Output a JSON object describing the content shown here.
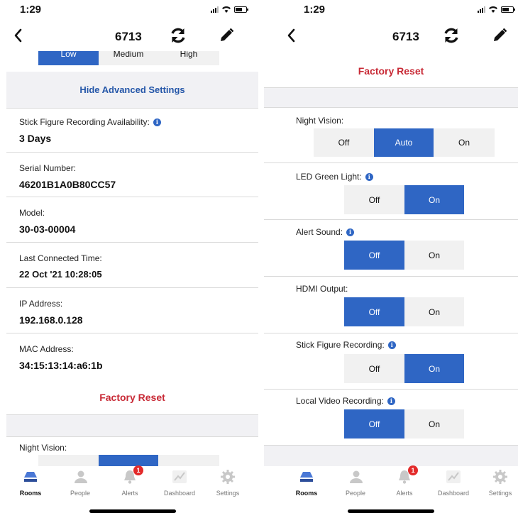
{
  "status": {
    "time": "1:29"
  },
  "device": {
    "title": "6713"
  },
  "left": {
    "sensitivity": [
      "Low",
      "Medium",
      "High"
    ],
    "advanced_link": "Hide Advanced Settings",
    "info": [
      {
        "label": "Stick Figure Recording Availability:",
        "value": "3 Days",
        "has_info": true
      },
      {
        "label": "Serial Number:",
        "value": "46201B1A0B80CC57"
      },
      {
        "label": "Model:",
        "value": "30-03-00004"
      },
      {
        "label": "Last Connected Time:",
        "value": "22 Oct '21 10:28:05"
      },
      {
        "label": "IP Address:",
        "value": "192.168.0.128"
      },
      {
        "label": "MAC Address:",
        "value": "34:15:13:14:a6:1b"
      }
    ],
    "factory_reset": "Factory Reset",
    "night_vision_label": "Night Vision:"
  },
  "right": {
    "factory_reset": "Factory Reset",
    "night_vision": {
      "label": "Night Vision:",
      "options": [
        "Off",
        "Auto",
        "On"
      ],
      "selected": "Auto"
    },
    "toggles": [
      {
        "label": "LED Green Light:",
        "has_info": true,
        "off": "Off",
        "on": "On",
        "selected": "On"
      },
      {
        "label": "Alert Sound:",
        "has_info": true,
        "off": "Off",
        "on": "On",
        "selected": "Off"
      },
      {
        "label": "HDMI Output:",
        "has_info": false,
        "off": "Off",
        "on": "On",
        "selected": "Off"
      },
      {
        "label": "Stick Figure Recording:",
        "has_info": true,
        "off": "Off",
        "on": "On",
        "selected": "On"
      },
      {
        "label": "Local Video Recording:",
        "has_info": true,
        "off": "Off",
        "on": "On",
        "selected": "Off"
      }
    ]
  },
  "tabs": [
    {
      "label": "Rooms",
      "icon": "rooms-icon",
      "active": true
    },
    {
      "label": "People",
      "icon": "people-icon"
    },
    {
      "label": "Alerts",
      "icon": "alerts-icon",
      "badge": "1"
    },
    {
      "label": "Dashboard",
      "icon": "dashboard-icon"
    },
    {
      "label": "Settings",
      "icon": "settings-icon"
    }
  ],
  "colors": {
    "accent": "#2f66c4",
    "danger": "#c82a36",
    "link": "#2456a8",
    "badge": "#e32a2a"
  }
}
